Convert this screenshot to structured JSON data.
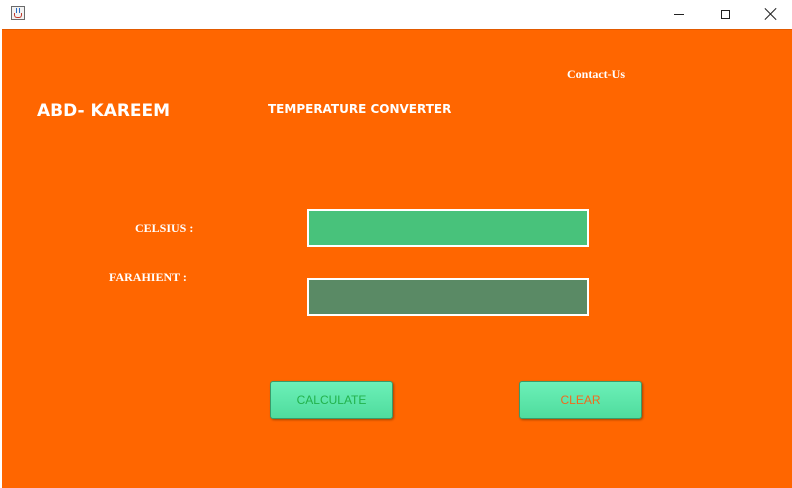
{
  "window": {
    "title": "",
    "controls": {
      "minimize": "minimize-icon",
      "maximize": "maximize-icon",
      "close": "close-icon"
    }
  },
  "header": {
    "brand": "ABD- KAREEM",
    "title": "TEMPERATURE CONVERTER",
    "contact_link": "Contact-Us"
  },
  "form": {
    "celsius_label": "CELSIUS  :",
    "celsius_value": "",
    "fahrenheit_label": "FARAHIENT :",
    "fahrenheit_value": ""
  },
  "buttons": {
    "calculate": "CALCULATE",
    "clear": "CLEAR"
  },
  "colors": {
    "background": "#ff6600",
    "celsius_field": "#48c27b",
    "fahrenheit_field": "#5a8a65",
    "button": "#5ee6aa",
    "calculate_text": "#22b24c",
    "clear_text": "#f06a1e"
  }
}
